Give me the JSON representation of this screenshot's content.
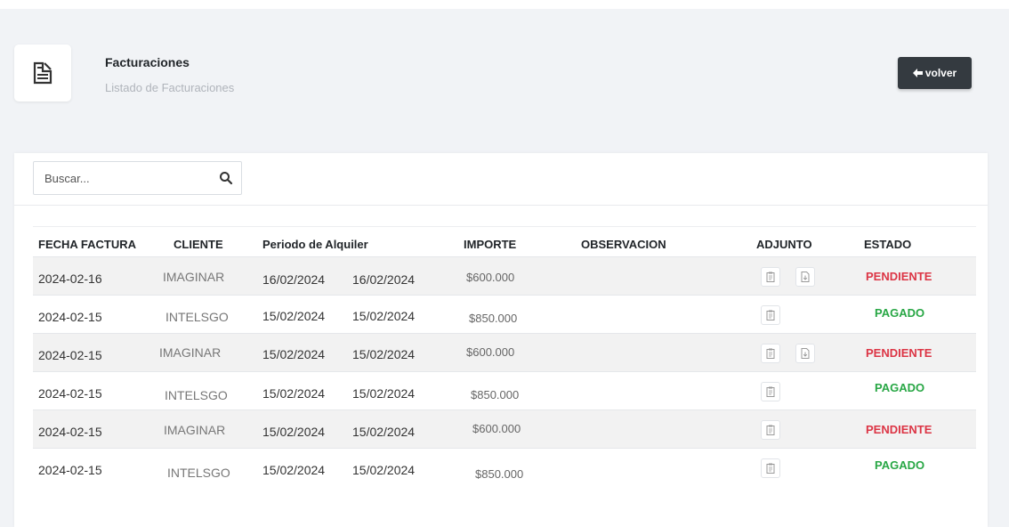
{
  "header": {
    "title": "Facturaciones",
    "subtitle": "Listado de Facturaciones",
    "icon": "document-icon",
    "back_label": "volver",
    "back_icon": "arrow-left-icon"
  },
  "search": {
    "placeholder": "Buscar...",
    "value": "",
    "icon": "search-icon"
  },
  "table": {
    "headers": {
      "fecha": "FECHA FACTURA",
      "cliente": "CLIENTE",
      "periodo": "Periodo de Alquiler",
      "importe": "IMPORTE",
      "observacion": "OBSERVACION",
      "adjunto": "ADJUNTO",
      "estado": "ESTADO"
    },
    "rows": [
      {
        "fecha": "2024-02-16",
        "cliente": "IMAGINAR",
        "desde": "16/02/2024",
        "hasta": "16/02/2024",
        "importe": "$600.000",
        "observacion": "",
        "estado": "PENDIENTE",
        "adjuntos": [
          "clipboard-icon",
          "file-download-icon"
        ]
      },
      {
        "fecha": "2024-02-15",
        "cliente": "INTELSGO",
        "desde": "15/02/2024",
        "hasta": "15/02/2024",
        "importe": "$850.000",
        "observacion": "",
        "estado": "PAGADO",
        "adjuntos": [
          "clipboard-icon"
        ]
      },
      {
        "fecha": "2024-02-15",
        "cliente": "IMAGINAR",
        "desde": "15/02/2024",
        "hasta": "15/02/2024",
        "importe": "$600.000",
        "observacion": "",
        "estado": "PENDIENTE",
        "adjuntos": [
          "clipboard-icon",
          "file-download-icon"
        ]
      },
      {
        "fecha": "2024-02-15",
        "cliente": "INTELSGO",
        "desde": "15/02/2024",
        "hasta": "15/02/2024",
        "importe": "$850.000",
        "observacion": "",
        "estado": "PAGADO",
        "adjuntos": [
          "clipboard-icon"
        ]
      },
      {
        "fecha": "2024-02-15",
        "cliente": "IMAGINAR",
        "desde": "15/02/2024",
        "hasta": "15/02/2024",
        "importe": "$600.000",
        "observacion": "",
        "estado": "PENDIENTE",
        "adjuntos": [
          "clipboard-icon"
        ]
      },
      {
        "fecha": "2024-02-15",
        "cliente": "INTELSGO",
        "desde": "15/02/2024",
        "hasta": "15/02/2024",
        "importe": "$850.000",
        "observacion": "",
        "estado": "PAGADO",
        "adjuntos": [
          "clipboard-icon"
        ]
      }
    ]
  },
  "colors": {
    "pendiente": "#dc3545",
    "pagado": "#28a745",
    "button_bg": "#343a40"
  }
}
